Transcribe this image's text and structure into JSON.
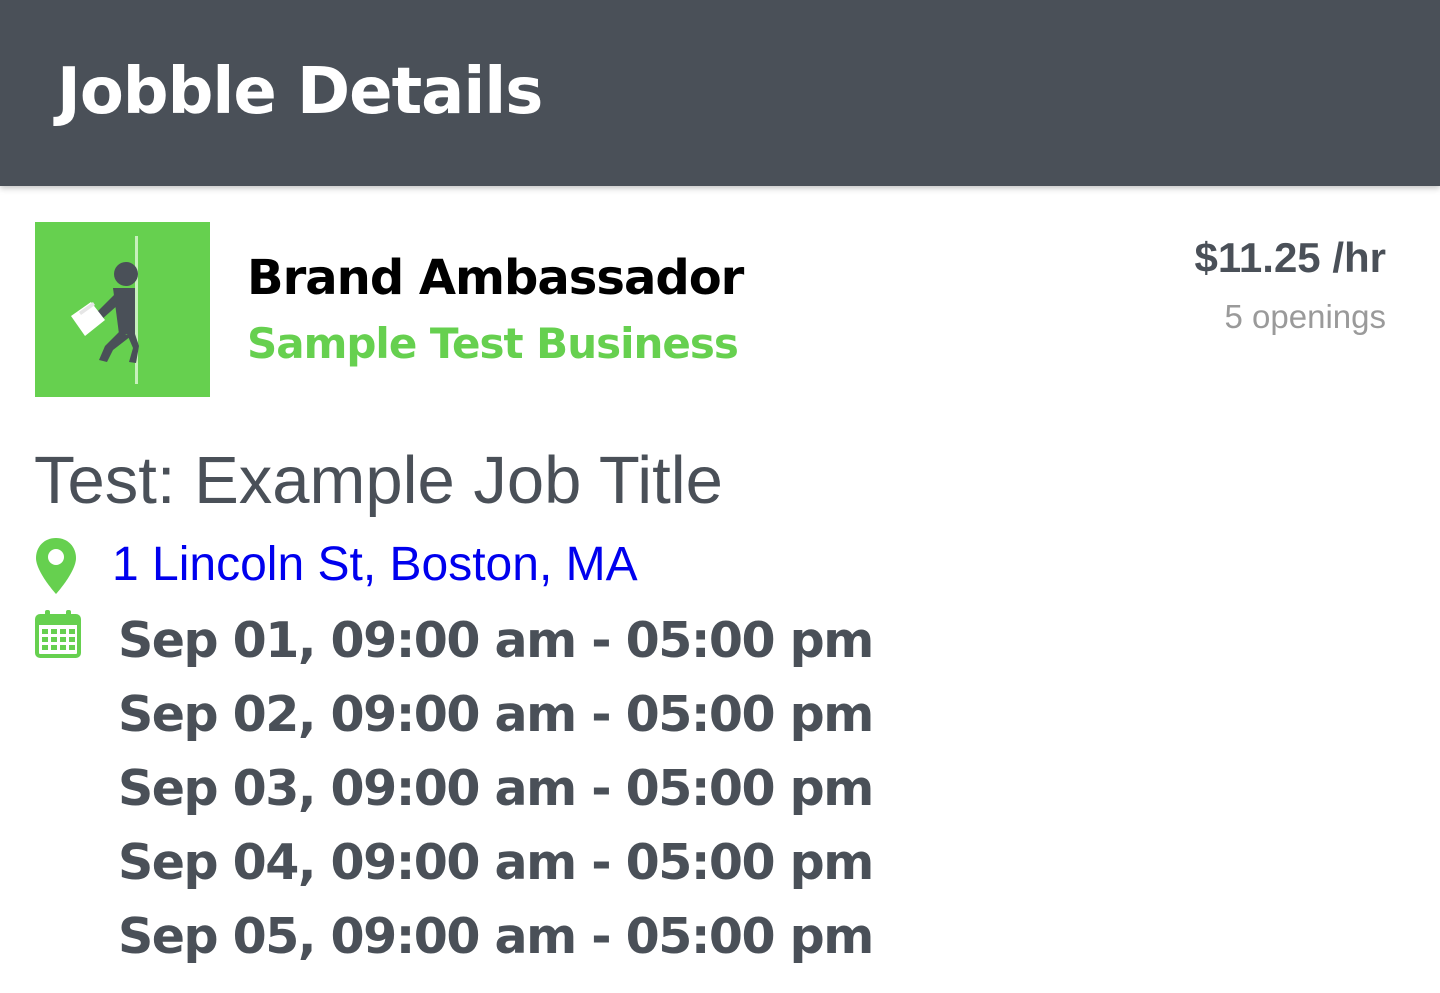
{
  "app_bar": {
    "title": "Jobble Details"
  },
  "job": {
    "logo_icon": "worker-carrying-papers-icon",
    "position": "Brand Ambassador",
    "business": "Sample Test Business",
    "pay_rate": "$11.25 /hr",
    "openings": "5 openings",
    "title": "Test: Example Job Title",
    "address": "1 Lincoln St, Boston, MA",
    "location_icon": "map-pin-icon",
    "calendar_icon": "calendar-icon",
    "schedule": [
      "Sep 01, 09:00 am - 05:00 pm",
      "Sep 02, 09:00 am - 05:00 pm",
      "Sep 03, 09:00 am - 05:00 pm",
      "Sep 04, 09:00 am - 05:00 pm",
      "Sep 05, 09:00 am - 05:00 pm"
    ]
  },
  "colors": {
    "app_bar": "#4a5058",
    "accent_green": "#66d04f",
    "link_blue": "#0000ee",
    "text_dark": "#4a5058",
    "text_muted": "#9a9a9a"
  }
}
